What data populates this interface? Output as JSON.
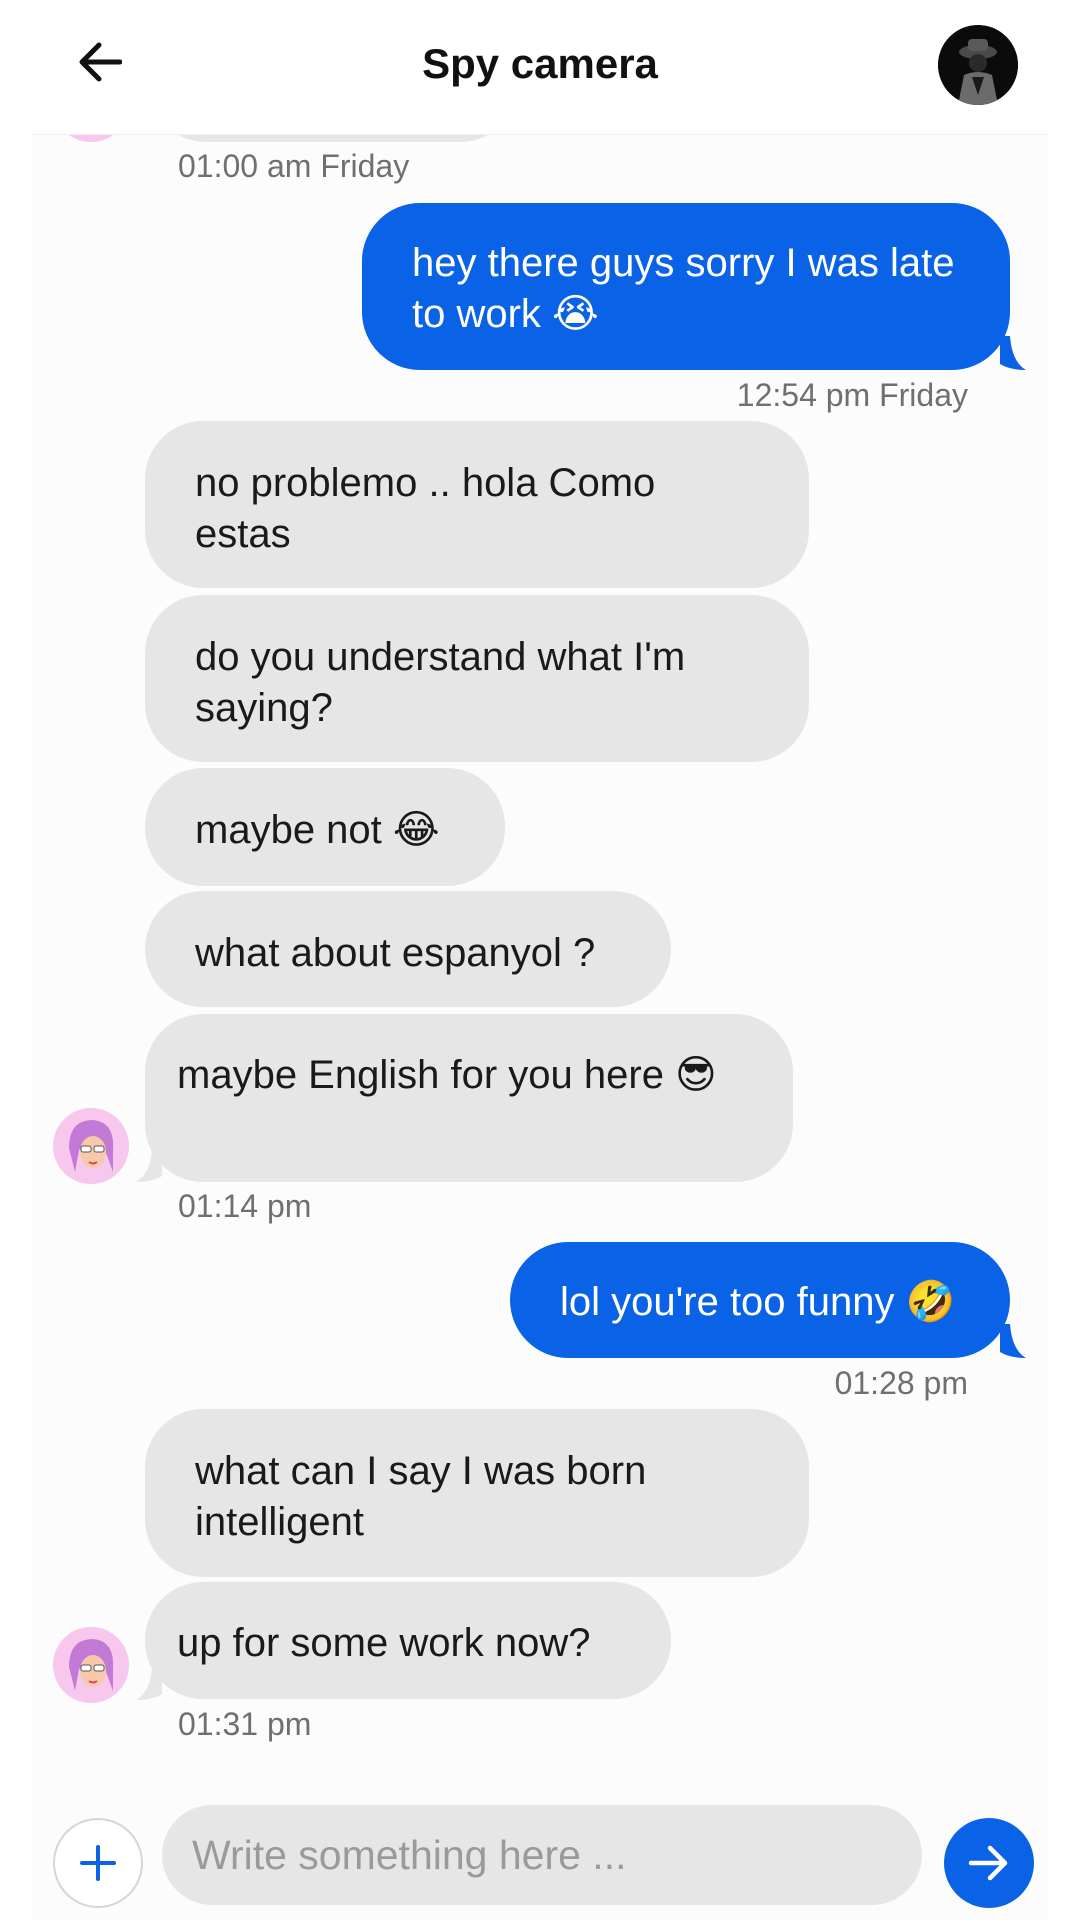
{
  "header": {
    "title": "Spy camera",
    "back_icon": "arrow-left-icon",
    "avatar_icon": "detective-avatar"
  },
  "messages": [
    {
      "direction": "in",
      "text": "",
      "timestamp": "01:00 am Friday"
    },
    {
      "direction": "out",
      "text": "hey there guys sorry I was late to work 😭",
      "timestamp": "12:54 pm Friday"
    },
    {
      "direction": "in",
      "text": "no problemo .. hola Como estas"
    },
    {
      "direction": "in",
      "text": "do you understand what I'm saying?"
    },
    {
      "direction": "in",
      "text": "maybe not 😂"
    },
    {
      "direction": "in",
      "text": "what about espanyol ?"
    },
    {
      "direction": "in",
      "text": "maybe English for you here 😎",
      "timestamp": "01:14 pm"
    },
    {
      "direction": "out",
      "text": "lol you're too funny 🤣",
      "timestamp": "01:28 pm"
    },
    {
      "direction": "in",
      "text": "what can I say I was born intelligent"
    },
    {
      "direction": "in",
      "text": "up for some work now?",
      "timestamp": "01:31 pm"
    }
  ],
  "composer": {
    "placeholder": "Write something here ...",
    "add_icon": "plus-icon",
    "send_icon": "arrow-right-icon"
  },
  "colors": {
    "accent": "#0a63e6",
    "incoming_bubble": "#e6e6e6",
    "timestamp": "#6f6f6f"
  }
}
